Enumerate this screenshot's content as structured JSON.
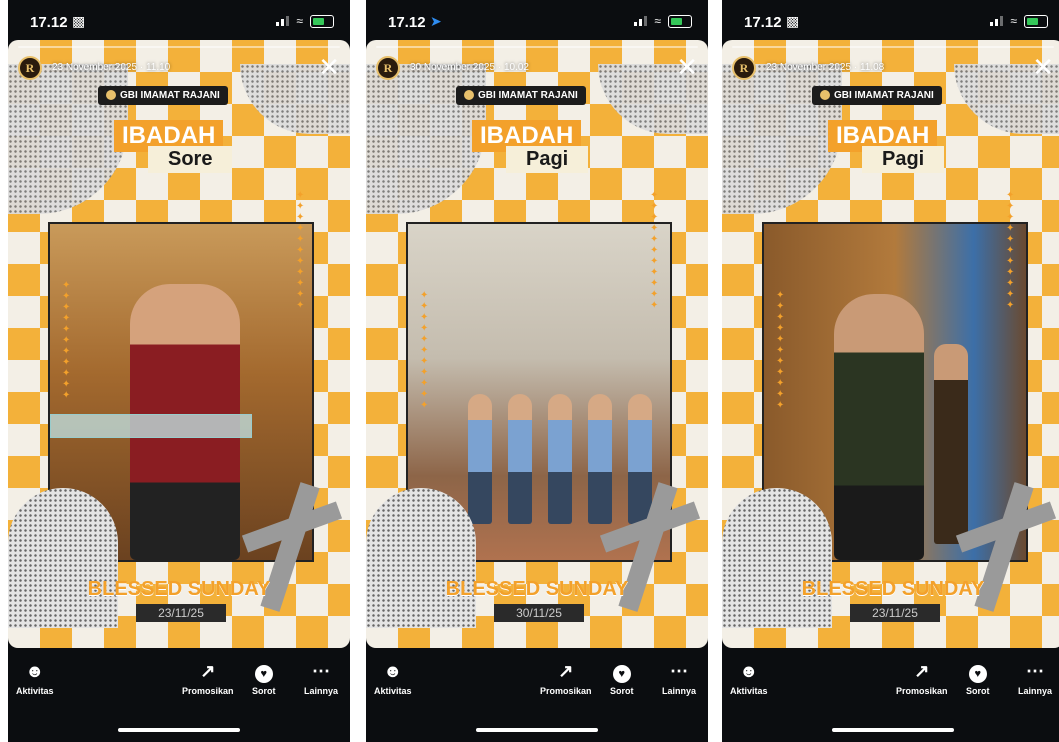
{
  "stories": [
    {
      "time": "17.12",
      "status_icon": "car-icon",
      "post_date": "23 November 2025 · 11.10",
      "church_tag": "GBI IMAMAT RAJANI",
      "title_word1": "IBADAH",
      "title_word2": "Sore",
      "blessed": "BLESSED SUNDAY",
      "date_label": "23/11/25"
    },
    {
      "time": "17.12",
      "status_icon": "location-icon",
      "post_date": "30 November 2025 · 10.02",
      "church_tag": "GBI IMAMAT RAJANI",
      "title_word1": "IBADAH",
      "title_word2": "Pagi",
      "blessed": "BLESSED SUNDAY",
      "date_label": "30/11/25"
    },
    {
      "time": "17.12",
      "status_icon": "car-icon",
      "post_date": "23 November 2025 · 11.08",
      "church_tag": "GBI IMAMAT RAJANI",
      "title_word1": "IBADAH",
      "title_word2": "Pagi",
      "blessed": "BLESSED SUNDAY",
      "date_label": "23/11/25"
    }
  ],
  "bottom_nav": {
    "aktivitas": "Aktivitas",
    "promosikan": "Promosikan",
    "sorot": "Sorot",
    "lainnya": "Lainnya"
  },
  "colors": {
    "accent": "#f3a12b",
    "background": "#0b0d10"
  }
}
